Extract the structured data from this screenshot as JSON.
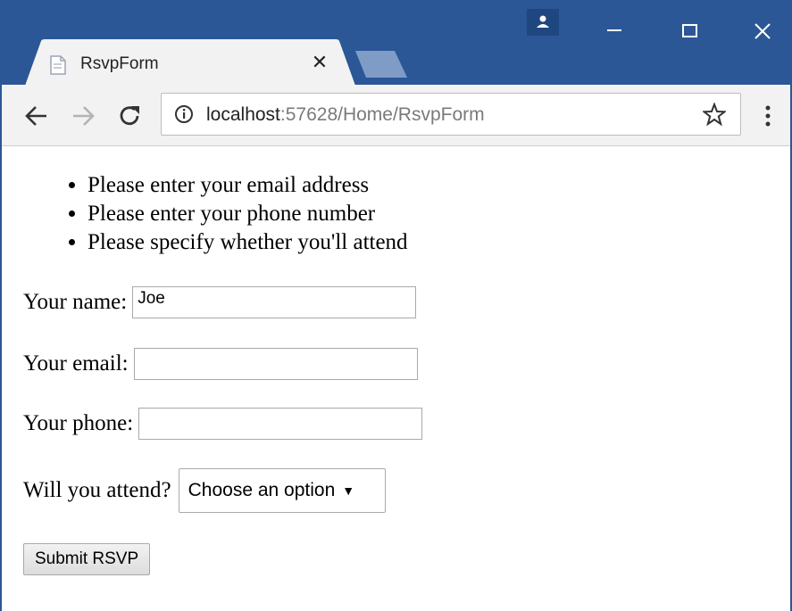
{
  "browser": {
    "tab_title": "RsvpForm",
    "tab_close": "✕",
    "url_host": "localhost",
    "url_rest": ":57628/Home/RsvpForm",
    "accent_color": "#2b5797"
  },
  "validation_errors": [
    "Please enter your email address",
    "Please enter your phone number",
    "Please specify whether you'll attend"
  ],
  "form": {
    "name_label": "Your name:",
    "name_value": "Joe",
    "email_label": "Your email:",
    "email_value": "",
    "phone_label": "Your phone:",
    "phone_value": "",
    "attend_label": "Will you attend?",
    "attend_selected": "Choose an option",
    "submit_label": "Submit RSVP"
  }
}
